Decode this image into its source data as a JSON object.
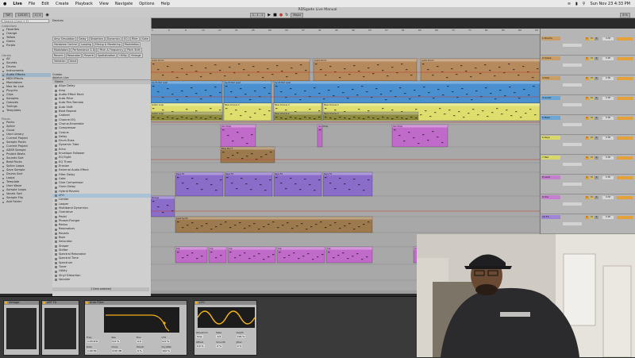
{
  "menubar": {
    "items": [
      "Live",
      "File",
      "Edit",
      "Create",
      "Playback",
      "View",
      "Navigate",
      "Options",
      "Help"
    ],
    "clock": "Sun Nov 23  4:33 PM"
  },
  "window": {
    "title": "RDSgade Live Manual"
  },
  "transport": {
    "tempo": "120.00",
    "sig": "4 / 4",
    "position": "1 . 1 . 1",
    "key": "Major",
    "cpu": "6 %"
  },
  "browser": {
    "search_placeholder": "Search (Cmd + F)",
    "collections_header": "Collections",
    "collections": [
      "Favorites",
      "Orange",
      "Yellow",
      "Green",
      "Purple"
    ],
    "library_header": "Library",
    "library": [
      "All",
      "Sounds",
      "Drums",
      "Instruments",
      "Audio Effects",
      "MIDI Effects",
      "Modulators",
      "Max for Live",
      "Plug-Ins",
      "Clips",
      "Samples",
      "Grooves",
      "Tunings",
      "Templates"
    ],
    "places_header": "Places",
    "places": [
      "Packs",
      "Splice",
      "Cloud",
      "User Library",
      "Current Project",
      "Sample Packs",
      "Current Project",
      "ADSR Sample",
      "Project Beats",
      "Sounds Sort",
      "Beat Packs",
      "Splice Loops",
      "Save Sample",
      "Drums Sort",
      "Loops",
      "Template",
      "User Wave",
      "Sample Loops",
      "Vocals Sort",
      "Sample Flip",
      "Add Folder"
    ],
    "tags": [
      "Amp Simulation",
      "Delay",
      "Distortion",
      "Dynamics",
      "EQ",
      "Filter",
      "Gate",
      "Hardware Control",
      "Looping",
      "Mixing & Mastering",
      "Modulation",
      "Modulators",
      "Performance & DJ",
      "Pitch & Frequency",
      "Pitch Shift",
      "Reverb",
      "Resonator",
      "Reverb",
      "Spatialization",
      "Utility",
      "Vintage",
      "Variation",
      "Vocal"
    ],
    "creator_label": "Creator",
    "creator_value": "Ableton  Live",
    "files_header": "Name",
    "files": [
      "Align Delay",
      "Amp",
      "Audio Effect Rack",
      "Auto Filter",
      "Auto Pan-Tremolo",
      "Auto Shift",
      "Beat Repeat",
      "Cabinet",
      "Channel EQ",
      "Chorus-Ensemble",
      "Compressor",
      "Corpus",
      "Delay",
      "Drum Buss",
      "Dynamic Tube",
      "Echo",
      "Envelope Follower",
      "EQ Eight",
      "EQ Three",
      "Erosion",
      "External Audio Effect",
      "Filter Delay",
      "Gate",
      "Glue Compressor",
      "Grain Delay",
      "Hybrid Reverb",
      "LFO",
      "Limiter",
      "Looper",
      "Multiband Dynamics",
      "Overdrive",
      "Pedal",
      "Phaser-Flanger",
      "Redux",
      "Resonators",
      "Reverb",
      "Roar",
      "Saturator",
      "Shaper",
      "Shifter",
      "Spectral Resonator",
      "Spectral Time",
      "Spectrum",
      "Tuner",
      "Utility",
      "Vinyl Distortion",
      "Vocoder"
    ],
    "selected_file": "LFO",
    "footer": "1 item selected"
  },
  "arrangement": {
    "ruler": [
      "1",
      "5",
      "9",
      "13",
      "17",
      "21",
      "25",
      "29",
      "33",
      "37",
      "41",
      "45",
      "49",
      "53",
      "57",
      "61",
      "65",
      "69",
      "73",
      "77",
      "81",
      "85",
      "89",
      "93"
    ],
    "clip_names": [
      "Audio Drum",
      "Synth Pad Lead",
      "Guitar Loop",
      "Bass Groove 2",
      "Vox Chop",
      "Bass Pad 3",
      "Keys FX",
      "Strings",
      "Lead Synth",
      "Arp"
    ]
  },
  "mixer": {
    "tracks": [
      "1 Drums",
      "2 Snare",
      "3 Kick",
      "4 Audio",
      "5 Bass",
      "6 Keys",
      "7 Pad",
      "8 Lead",
      "9 Vox",
      "10 FX",
      "11 Strings",
      "12 Arp",
      "Main"
    ],
    "track_colors": [
      "#c99d63",
      "#c99d63",
      "#c99d63",
      "#6aa7d6",
      "#6aa7d6",
      "#d8d86a",
      "#d8d86a",
      "#c67fd0",
      "#c67fd0",
      "#a084d6",
      "#a084d6",
      "#9e8a5a",
      "#e3a13a"
    ],
    "btn_labels": [
      "S",
      "M",
      "R"
    ],
    "vol_labels": [
      "0 dB",
      "-inf",
      "0"
    ]
  },
  "devices": {
    "dev1_title": "Vintage",
    "dev2_title": "ART FX",
    "dev3_title": "Auto Filter",
    "dev4_title": "LFO",
    "autofilter_params": [
      "Freq",
      "Res",
      "Env",
      "LFO",
      "Rate",
      "Drive",
      "Morph",
      "Dry/Wet"
    ],
    "autofilter_values": [
      "1.03 kHz",
      "0.0 %",
      "0.0",
      "0.0 %",
      "1.00 Hz",
      "0.00 dB",
      "0 %",
      "100 %"
    ],
    "lfo_params": [
      "Waveform",
      "Rate",
      "Depth",
      "Offset",
      "Smooth",
      "Jitter"
    ],
    "lfo_values": [
      "Sine",
      "1/4",
      "100 %",
      "0.0 %",
      "0 %",
      "0 %"
    ]
  },
  "colors": {
    "drum": "#b58a5c",
    "blue": "#4a8fd0",
    "yellow": "#dede6e",
    "olive": "#8c8a3c",
    "pink": "#c06bc9",
    "brown": "#9c7a4e",
    "purple": "#8a6cc9",
    "orange": "#f3b017"
  }
}
